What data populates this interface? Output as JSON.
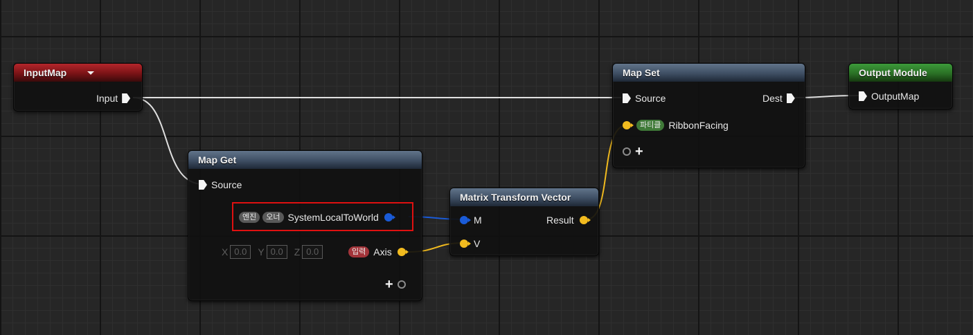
{
  "nodes": {
    "input_map": {
      "title": "InputMap",
      "out_label": "Input"
    },
    "map_get": {
      "title": "Map Get",
      "source_label": "Source",
      "row1": {
        "badge1": "엔진",
        "badge2": "오너",
        "label": "SystemLocalToWorld"
      },
      "xyz": {
        "x_label": "X",
        "x_value": "0.0",
        "y_label": "Y",
        "y_value": "0.0",
        "z_label": "Z",
        "z_value": "0.0"
      },
      "row2": {
        "badge": "입력",
        "label": "Axis"
      },
      "add": "+"
    },
    "matrix": {
      "title": "Matrix Transform Vector",
      "m_label": "M",
      "v_label": "V",
      "result_label": "Result"
    },
    "map_set": {
      "title": "Map Set",
      "source_label": "Source",
      "dest_label": "Dest",
      "row1": {
        "badge": "파티클",
        "label": "RibbonFacing"
      },
      "add": "+"
    },
    "output_module": {
      "title": "Output Module",
      "out_label": "OutputMap"
    }
  },
  "colors": {
    "exec_wire": "#e6e6e6",
    "matrix_wire": "#1a5bd8",
    "vector_wire": "#f2bb1f",
    "highlight": "#e01010"
  }
}
